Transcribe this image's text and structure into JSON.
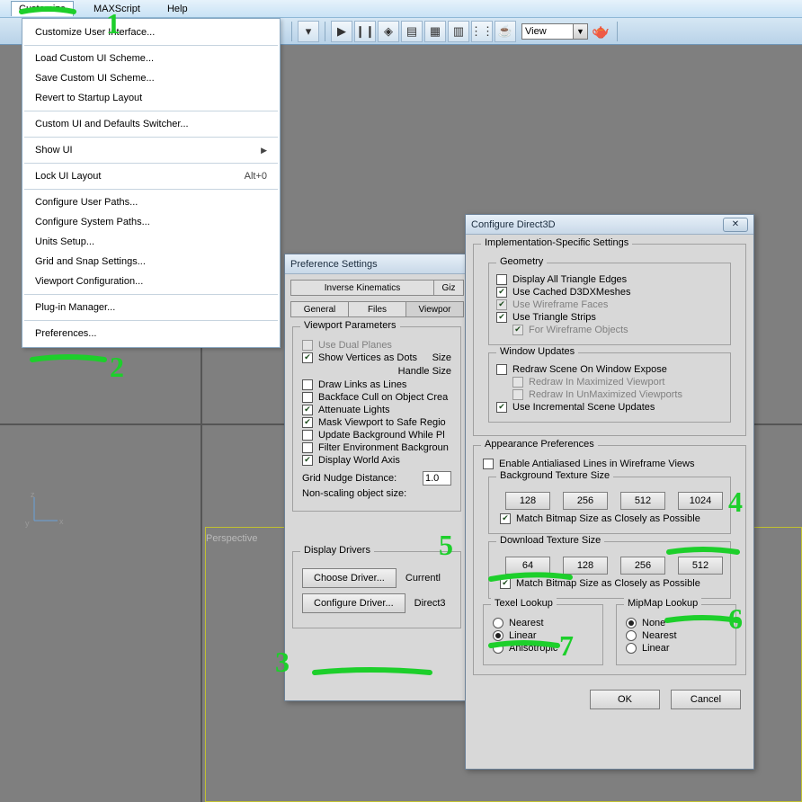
{
  "menubar": {
    "customize": "Customize",
    "maxscript": "MAXScript",
    "help": "Help"
  },
  "dropdown": {
    "items": [
      {
        "label": "Customize User Interface..."
      },
      {
        "sep": true
      },
      {
        "label": "Load Custom UI Scheme..."
      },
      {
        "label": "Save Custom UI Scheme..."
      },
      {
        "label": "Revert to Startup Layout"
      },
      {
        "sep": true
      },
      {
        "label": "Custom UI and Defaults Switcher..."
      },
      {
        "sep": true
      },
      {
        "label": "Show UI",
        "arrow": true
      },
      {
        "sep": true
      },
      {
        "label": "Lock UI Layout",
        "shortcut": "Alt+0"
      },
      {
        "sep": true
      },
      {
        "label": "Configure User Paths..."
      },
      {
        "label": "Configure System Paths..."
      },
      {
        "label": "Units Setup..."
      },
      {
        "label": "Grid and Snap Settings..."
      },
      {
        "label": "Viewport Configuration..."
      },
      {
        "sep": true
      },
      {
        "label": "Plug-in Manager..."
      },
      {
        "sep": true
      },
      {
        "label": "Preferences..."
      }
    ]
  },
  "toolbar": {
    "view_value": "View"
  },
  "viewport": {
    "persp_label": "Perspective",
    "axes": {
      "x": "x",
      "y": "y",
      "z": "z"
    }
  },
  "pref": {
    "title": "Preference Settings",
    "tabs_row1": [
      "Inverse Kinematics",
      "Giz"
    ],
    "tabs_row2": [
      "General",
      "Files",
      "Viewpor"
    ],
    "vp_group": "Viewport Parameters",
    "vp_use_dual": "Use Dual Planes",
    "vp_show_dots": "Show Vertices as Dots",
    "vp_size_lbl": "Size",
    "vp_handle_size": "Handle Size",
    "vp_draw_links": "Draw Links as Lines",
    "vp_backface": "Backface Cull on Object Crea",
    "vp_attenuate": "Attenuate Lights",
    "vp_mask_safe": "Mask Viewport to Safe Regio",
    "vp_update_bg": "Update Background While Pl",
    "vp_filter_env": "Filter Environment Backgroun",
    "vp_disp_axis": "Display World Axis",
    "vp_grid_nudge": "Grid Nudge Distance:",
    "vp_grid_val": "1.0",
    "vp_nonscale": "Non-scaling object size:",
    "dd_group": "Display Drivers",
    "dd_choose": "Choose Driver...",
    "dd_currently": "Currentl",
    "dd_configure": "Configure Driver...",
    "dd_direct3": "Direct3"
  },
  "d3d": {
    "title": "Configure Direct3D",
    "impl_group": "Implementation-Specific Settings",
    "geom_group": "Geometry",
    "geom_triangle_edges": "Display All Triangle Edges",
    "geom_cached": "Use Cached D3DXMeshes",
    "geom_wireframe": "Use Wireframe Faces",
    "geom_tristrips": "Use Triangle Strips",
    "geom_for_wire": "For Wireframe Objects",
    "win_group": "Window Updates",
    "win_redraw": "Redraw Scene On Window Expose",
    "win_redraw_max": "Redraw In Maximized Viewport",
    "win_redraw_unmax": "Redraw In UnMaximized Viewports",
    "win_incremental": "Use Incremental Scene Updates",
    "appear_group": "Appearance Preferences",
    "appear_aa": "Enable Antialiased Lines in Wireframe Views",
    "bg_tex_group": "Background Texture Size",
    "bg_sizes": [
      "128",
      "256",
      "512",
      "1024"
    ],
    "match_bitmap": "Match Bitmap Size as Closely as Possible",
    "dl_tex_group": "Download Texture Size",
    "dl_sizes": [
      "64",
      "128",
      "256",
      "512"
    ],
    "texel_group": "Texel Lookup",
    "texel_nearest": "Nearest",
    "texel_linear": "Linear",
    "texel_aniso": "Anisotropic",
    "mip_group": "MipMap Lookup",
    "mip_none": "None",
    "mip_nearest": "Nearest",
    "mip_linear": "Linear",
    "ok": "OK",
    "cancel": "Cancel"
  },
  "annotations": {
    "n1": "1",
    "n2": "2",
    "n3": "3",
    "n4": "4",
    "n5": "5",
    "n6": "6",
    "n7": "7"
  }
}
